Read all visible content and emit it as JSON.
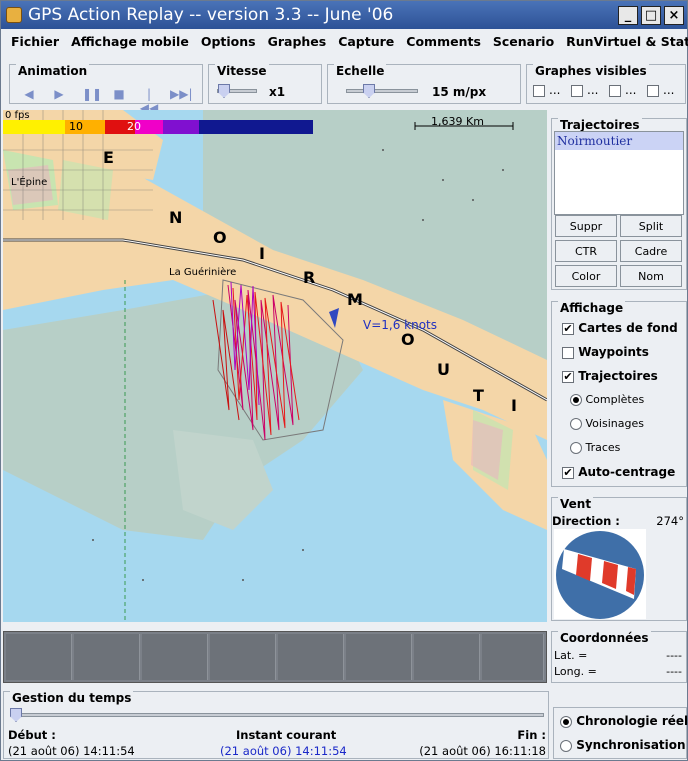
{
  "window": {
    "title": "GPS Action Replay -- version 3.3 -- June '06"
  },
  "menu": [
    "Fichier",
    "Affichage mobile",
    "Options",
    "Graphes",
    "Capture",
    "Comments",
    "Scenario",
    "RunVirtuel & Stats",
    "?"
  ],
  "animation": {
    "label": "Animation"
  },
  "vitesse": {
    "label": "Vitesse",
    "value": "x1"
  },
  "echelle": {
    "label": "Echelle",
    "value": "15 m/px"
  },
  "graphes": {
    "label": "Graphes visibles"
  },
  "map": {
    "fps": "0 fps",
    "scale_num": "10",
    "scale_num2": "20",
    "distance": "1,639 Km",
    "speed_label": "V=1,6 knots",
    "place_lepine": "L'Épine",
    "place_gueriniere": "La Guérinière",
    "island_letters": [
      "E",
      "N",
      "O",
      "I",
      "R",
      "M",
      "O",
      "U",
      "T",
      "I"
    ]
  },
  "trajectoires": {
    "label": "Trajectoires",
    "items": [
      "Noirmoutier"
    ],
    "buttons": [
      "Suppr",
      "Split",
      "CTR",
      "Cadre",
      "Color",
      "Nom"
    ]
  },
  "affichage": {
    "label": "Affichage",
    "cartes": "Cartes de fond",
    "waypoints": "Waypoints",
    "traj": "Trajectoires",
    "completes": "Complètes",
    "voisinages": "Voisinages",
    "traces": "Traces",
    "autocentrage": "Auto-centrage"
  },
  "vent": {
    "label": "Vent",
    "direction_label": "Direction :",
    "direction_value": "274°"
  },
  "coordonnees": {
    "label": "Coordonnées",
    "lat_label": "Lat. =",
    "lat_value": "----",
    "long_label": "Long. =",
    "long_value": "----"
  },
  "temps": {
    "label": "Gestion du temps",
    "debut_label": "Début :",
    "debut_value": "(21 août 06) 14:11:54",
    "instant_label": "Instant courant",
    "instant_value": "(21 août 06) 14:11:54",
    "fin_label": "Fin :",
    "fin_value": "(21 août 06) 16:11:18",
    "chrono": "Chronologie réelle",
    "synchro": "Synchronisation"
  }
}
